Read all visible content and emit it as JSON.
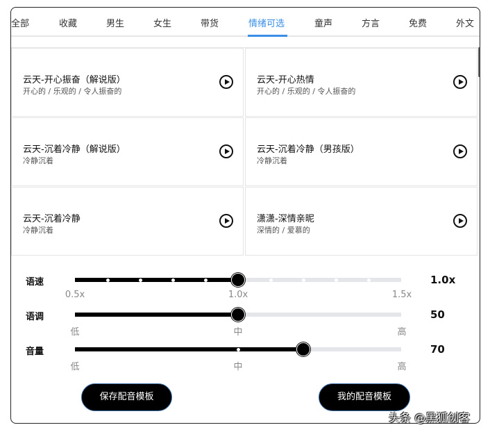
{
  "tabs": [
    {
      "label": "全部"
    },
    {
      "label": "收藏"
    },
    {
      "label": "男生"
    },
    {
      "label": "女生"
    },
    {
      "label": "带货"
    },
    {
      "label": "情绪可选",
      "active": true
    },
    {
      "label": "童声"
    },
    {
      "label": "方言"
    },
    {
      "label": "免费"
    },
    {
      "label": "外文"
    }
  ],
  "voices": [
    {
      "title": "云天-开心振奋（解说版）",
      "tags": "开心的 / 乐观的 / 令人振奋的"
    },
    {
      "title": "云天-开心热情",
      "tags": "开心的 / 乐观的 / 令人振奋的"
    },
    {
      "title": "云天-沉着冷静（解说版）",
      "tags": "冷静沉着"
    },
    {
      "title": "云天-沉着冷静（男孩版）",
      "tags": "冷静沉着"
    },
    {
      "title": "云天-沉着冷静",
      "tags": "冷静沉着"
    },
    {
      "title": "潇潇-深情亲昵",
      "tags": "深情的 / 爱慕的"
    }
  ],
  "sliders": {
    "speed": {
      "label": "语速",
      "value": "1.0x",
      "fraction": 0.5,
      "ticks": [
        "0.5x",
        "1.0x",
        "1.5x"
      ]
    },
    "pitch": {
      "label": "语调",
      "value": "50",
      "fraction": 0.5,
      "ticks": [
        "低",
        "中",
        "高"
      ]
    },
    "volume": {
      "label": "音量",
      "value": "70",
      "fraction": 0.7,
      "ticks": [
        "低",
        "中",
        "高"
      ]
    }
  },
  "buttons": {
    "save": "保存配音模板",
    "mine": "我的配音模板"
  },
  "watermark": "头条 @黑狐创客",
  "colors": {
    "accent": "#3a8ee6"
  }
}
